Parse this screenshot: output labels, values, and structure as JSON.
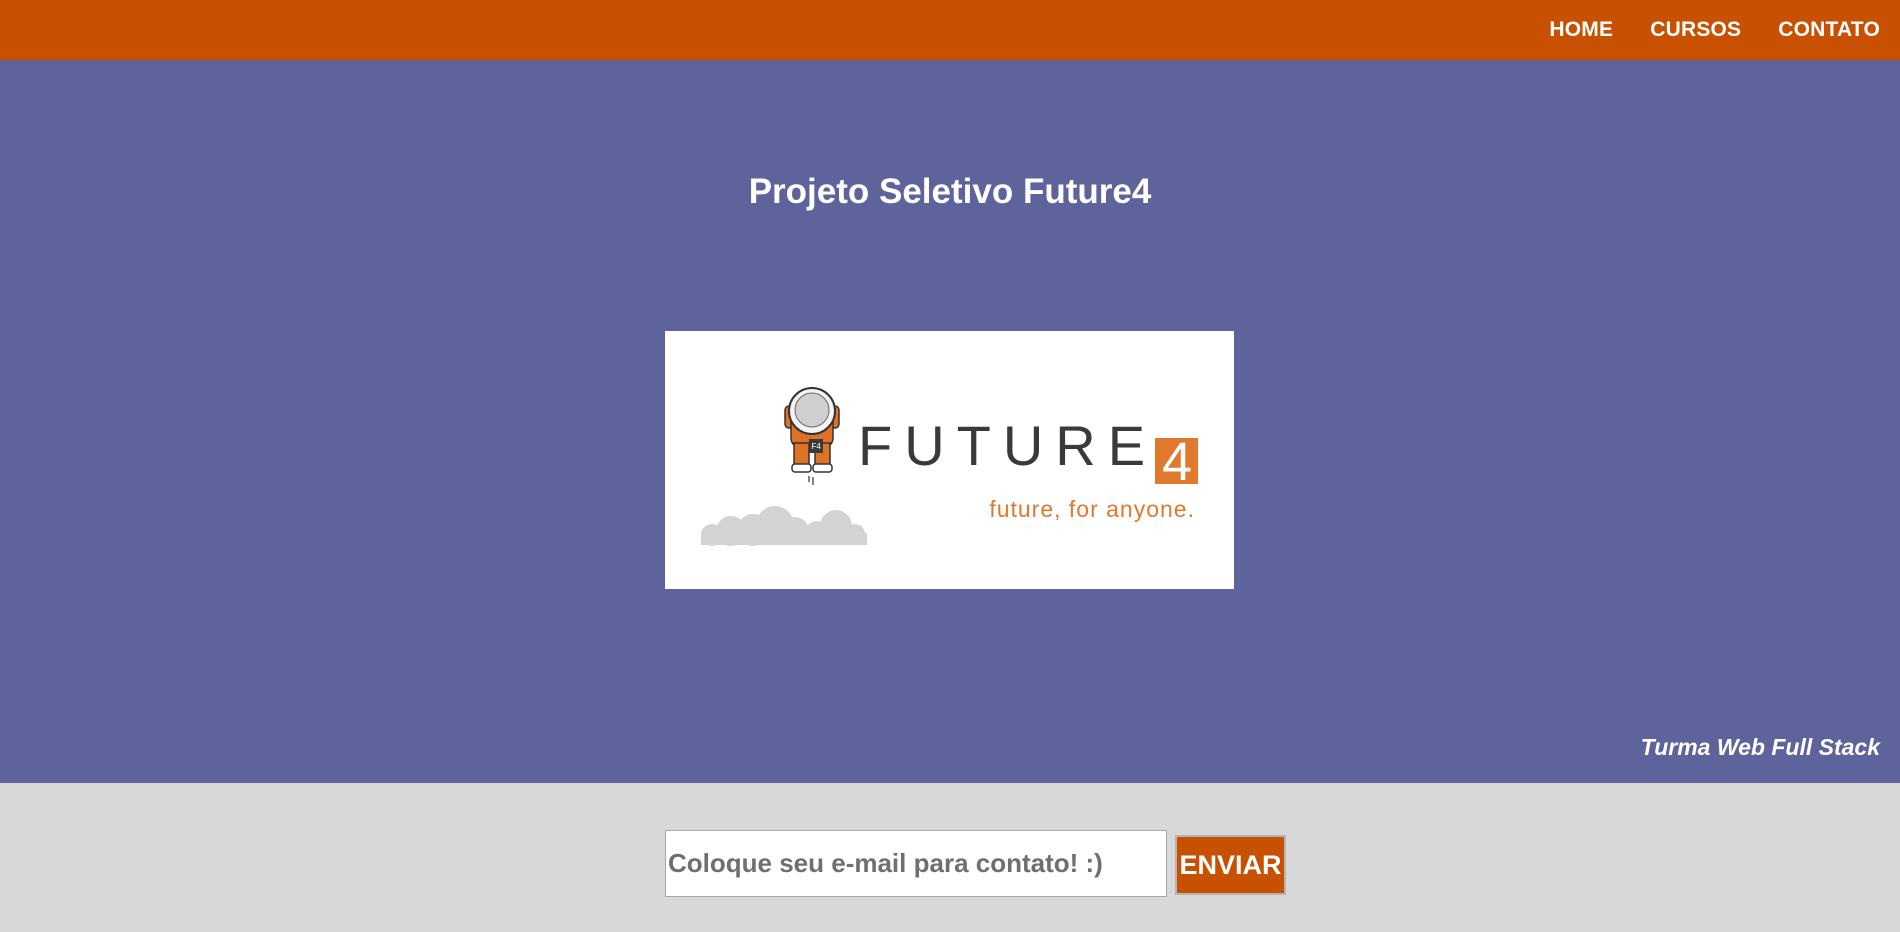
{
  "nav": {
    "items": [
      {
        "label": "HOME"
      },
      {
        "label": "CURSOS"
      },
      {
        "label": "CONTATO"
      }
    ]
  },
  "hero": {
    "title": "Projeto Seletivo Future4",
    "tagline": "Turma Web Full Stack"
  },
  "logo": {
    "wordmark": "FUTURE",
    "wordmark_digit": "4",
    "slogan": "future, for anyone.",
    "patch": "F4"
  },
  "contact": {
    "email_placeholder": "Coloque seu e-mail para contato! :)",
    "email_value": "",
    "send_label": "ENVIAR"
  },
  "colors": {
    "brand_orange": "#c75001",
    "hero_background": "#5e639b",
    "footer_background": "#d8d8d8"
  }
}
